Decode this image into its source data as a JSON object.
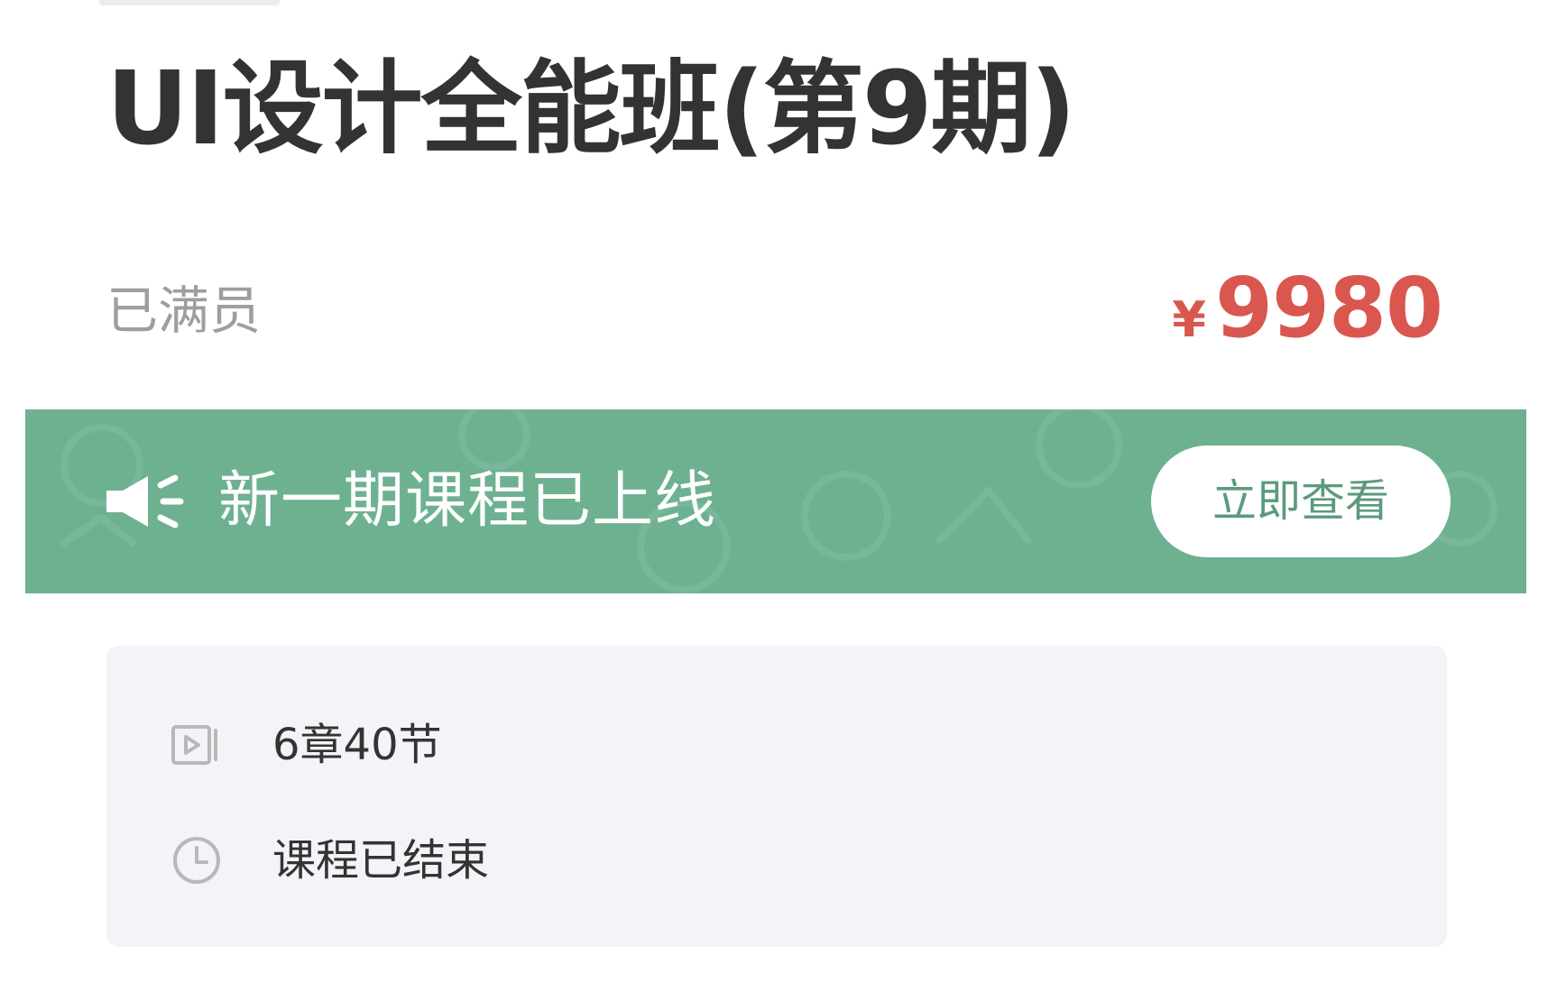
{
  "course": {
    "title": "UI设计全能班(第9期)",
    "status": "已满员",
    "price_symbol": "¥",
    "price_value": "9980"
  },
  "banner": {
    "text": "新一期课程已上线",
    "button_label": "立即查看",
    "background_color": "#6db191",
    "icon": "speaker-icon"
  },
  "details": {
    "lessons_text": "6章40节",
    "lessons_icon": "video-lessons-icon",
    "schedule_text": "课程已结束",
    "schedule_icon": "clock-icon"
  },
  "colors": {
    "price": "#d9574f",
    "banner": "#6db191",
    "card_background": "#f2f4f7"
  }
}
